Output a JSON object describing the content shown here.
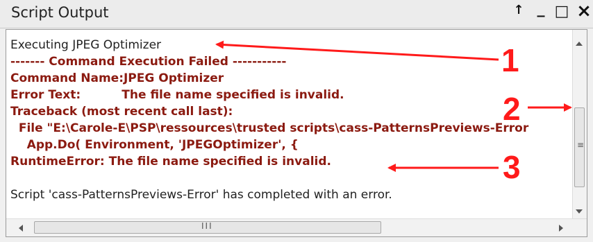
{
  "window": {
    "title": "Script Output",
    "buttons": {
      "pin": "↑",
      "minimize": "_",
      "maximize": "□",
      "close": "×"
    }
  },
  "output": {
    "lines": [
      {
        "text": "Executing JPEG Optimizer",
        "style": "normal"
      },
      {
        "text": "------- Command Execution Failed -----------",
        "style": "err"
      },
      {
        "text": "Command Name:JPEG Optimizer",
        "style": "err"
      },
      {
        "text": "Error Text:          The file name specified is invalid.",
        "style": "err"
      },
      {
        "text": "Traceback (most recent call last):",
        "style": "err"
      },
      {
        "text": "  File \"E:\\Carole-E\\PSP\\ressources\\trusted scripts\\cass-PatternsPreviews-Error",
        "style": "err"
      },
      {
        "text": "    App.Do( Environment, 'JPEGOptimizer', {",
        "style": "err"
      },
      {
        "text": "RuntimeError: The file name specified is invalid.",
        "style": "err"
      },
      {
        "text": "",
        "style": "normal"
      },
      {
        "text": "Script 'cass-PatternsPreviews-Error' has completed with an error.",
        "style": "normal"
      }
    ]
  },
  "annotations": {
    "one": "1",
    "two": "2",
    "three": "3"
  },
  "colors": {
    "annotation": "#ff1a1a",
    "error_text": "#8b1a10"
  },
  "scrollbar": {
    "grip": "≡",
    "hgrip": "III"
  }
}
